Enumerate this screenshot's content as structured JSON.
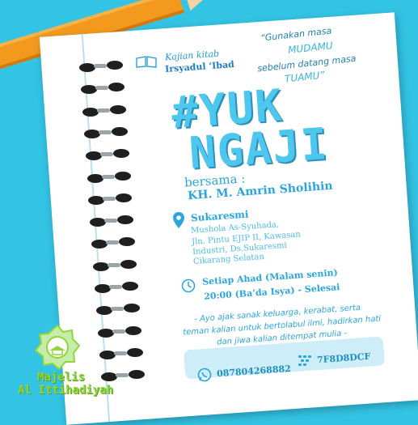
{
  "quote": {
    "line1": "“Gunakan masa",
    "line2": "MUDAMU",
    "line3": "sebelum datang masa",
    "line4": "TUAMU”"
  },
  "kajian": {
    "label": "Kajian kitab",
    "title": "Irsyadul ‘Ibad"
  },
  "headline": {
    "line1": "#YUK",
    "line2": "NGAJI"
  },
  "bersama": "bersama :",
  "speaker": "KH. M. Amrin Sholihin",
  "location": {
    "title": "Sukaresmi",
    "lines": [
      "Mushola As-Syuhada,",
      "Jln. Pintu EJIP II, Kawasan",
      "Industri, Ds.Sukaresmi",
      "Cikarang Selatan"
    ]
  },
  "schedule": {
    "line1": "Setiap Ahad (Malam senin)",
    "line2": "20:00 (Ba’da Isya) - Selesai"
  },
  "invite": {
    "line1": "- Ayo ajak sanak keluarga, kerabat, serta",
    "line2": "teman kalian untuk bertolabul ilmi, hadirkan hati",
    "line3": "dan jiwa kalian ditempat mulia -"
  },
  "contact": {
    "whatsapp": "087804268882",
    "bbm": "7F8D8DCF"
  },
  "organization": {
    "line1": "Majelis",
    "line2": "Al Ittihadiyah"
  },
  "colors": {
    "background": "#33c3e4",
    "accent": "#2aa5de",
    "org_green": "#8fd63a"
  },
  "icons": [
    "pencil-icon",
    "book-icon",
    "location-pin-icon",
    "clock-icon",
    "whatsapp-icon",
    "bbm-icon",
    "crest-logo"
  ]
}
